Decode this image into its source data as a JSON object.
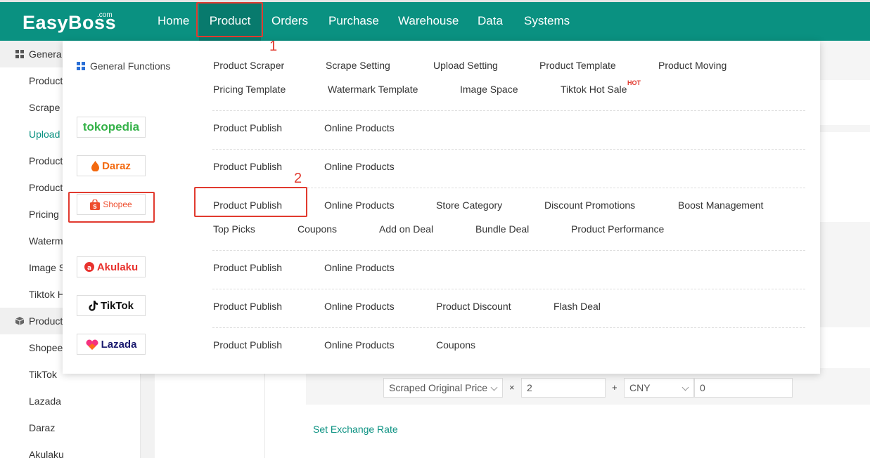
{
  "logo": {
    "text": "EasyBoss",
    "com": ".com"
  },
  "nav": [
    {
      "label": "Home"
    },
    {
      "label": "Product"
    },
    {
      "label": "Orders"
    },
    {
      "label": "Purchase"
    },
    {
      "label": "Warehouse"
    },
    {
      "label": "Data"
    },
    {
      "label": "Systems"
    }
  ],
  "annotations": {
    "step1": "1",
    "step2": "2"
  },
  "sidebar": {
    "group1": "Genera",
    "items1": [
      "Product",
      "Scrape",
      "Upload",
      "Product",
      "Product",
      "Pricing",
      "Waterm",
      "Image S",
      "Tiktok H"
    ],
    "group2": "Product",
    "items2": [
      "Shopee",
      "TikTok",
      "Lazada",
      "Daraz",
      "Akulaku"
    ]
  },
  "mega": {
    "general": {
      "label": "General Functions",
      "row1": [
        "Product Scraper",
        "Scrape Setting",
        "Upload Setting",
        "Product Template",
        "Product Moving"
      ],
      "row2": [
        "Pricing Template",
        "Watermark Template",
        "Image Space",
        "Tiktok Hot Sale"
      ],
      "hot": "HOT"
    },
    "tokopedia": {
      "logo": "tokopedia",
      "items": [
        "Product Publish",
        "Online Products"
      ]
    },
    "daraz": {
      "logo": "Daraz",
      "items": [
        "Product Publish",
        "Online Products"
      ]
    },
    "shopee": {
      "logo": "Shopee",
      "row1": [
        "Product Publish",
        "Online Products",
        "Store Category",
        "Discount Promotions",
        "Boost Management"
      ],
      "row2": [
        "Top Picks",
        "Coupons",
        "Add on Deal",
        "Bundle Deal",
        "Product Performance"
      ]
    },
    "akulaku": {
      "logo": "Akulaku",
      "items": [
        "Product Publish",
        "Online Products"
      ]
    },
    "tiktok": {
      "logo": "TikTok",
      "items": [
        "Product Publish",
        "Online Products",
        "Product Discount",
        "Flash Deal"
      ]
    },
    "lazada": {
      "logo": "Lazada",
      "items": [
        "Product Publish",
        "Online Products",
        "Coupons"
      ]
    }
  },
  "formula": {
    "source": "Scraped Original Price",
    "times": "×",
    "multiplier": "2",
    "plus": "+",
    "currency": "CNY",
    "addend": "0"
  },
  "exchange_link": "Set Exchange Rate",
  "colors": {
    "brand": "#0a9181",
    "highlight": "#e13a2f"
  }
}
